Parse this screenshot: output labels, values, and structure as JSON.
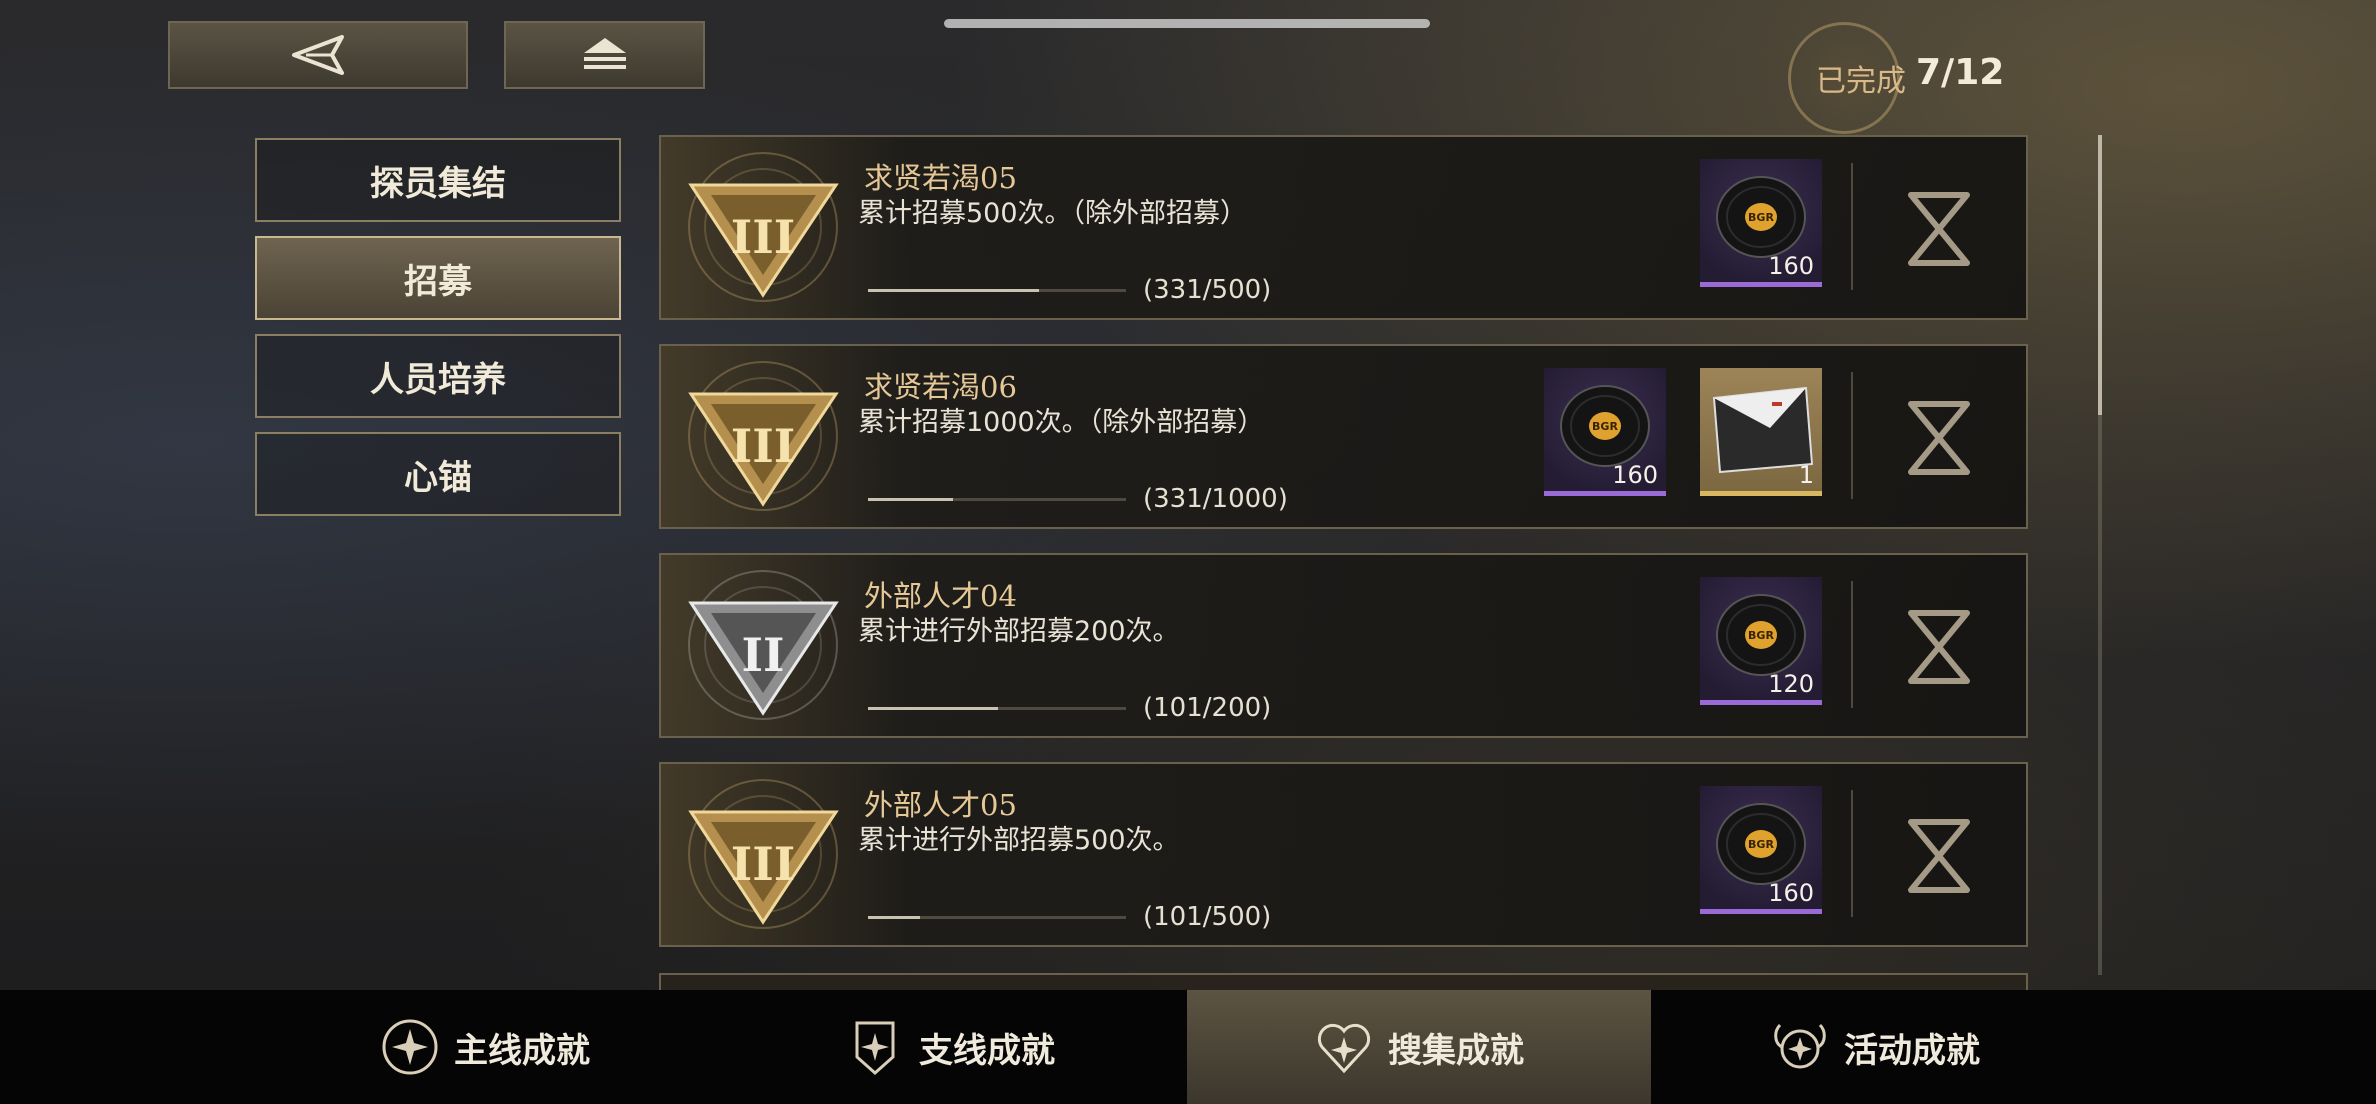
{
  "nav": {
    "back_label": "back",
    "home_label": "home"
  },
  "progress": {
    "label": "已完成",
    "value": "7/12"
  },
  "sidebar": {
    "items": [
      {
        "label": "探员集结",
        "active": false
      },
      {
        "label": "招募",
        "active": true
      },
      {
        "label": "人员培养",
        "active": false
      },
      {
        "label": "心锚",
        "active": false
      }
    ]
  },
  "achievements": [
    {
      "tier": "III",
      "tier_color": "gold",
      "title": "求贤若渴05",
      "description": "累计招募500次。（除外部招募）",
      "progress_text": "(331/500)",
      "progress": 0.662,
      "rewards": [
        {
          "icon": "vinyl-record-icon",
          "quantity": "160"
        }
      ],
      "status_icon": "hourglass-icon"
    },
    {
      "tier": "III",
      "tier_color": "gold",
      "title": "求贤若渴06",
      "description": "累计招募1000次。（除外部招募）",
      "progress_text": "(331/1000)",
      "progress": 0.331,
      "rewards": [
        {
          "icon": "vinyl-record-icon",
          "quantity": "160"
        },
        {
          "icon": "card-item-icon",
          "quantity": "1"
        }
      ],
      "status_icon": "hourglass-icon"
    },
    {
      "tier": "II",
      "tier_color": "silver",
      "title": "外部人才04",
      "description": "累计进行外部招募200次。",
      "progress_text": "(101/200)",
      "progress": 0.505,
      "rewards": [
        {
          "icon": "vinyl-record-icon",
          "quantity": "120"
        }
      ],
      "status_icon": "hourglass-icon"
    },
    {
      "tier": "III",
      "tier_color": "gold",
      "title": "外部人才05",
      "description": "累计进行外部招募500次。",
      "progress_text": "(101/500)",
      "progress": 0.202,
      "rewards": [
        {
          "icon": "vinyl-record-icon",
          "quantity": "160"
        }
      ],
      "status_icon": "hourglass-icon"
    }
  ],
  "bottom_tabs": [
    {
      "label": "主线成就",
      "icon": "compass-star-icon",
      "active": false
    },
    {
      "label": "支线成就",
      "icon": "shield-star-icon",
      "active": false
    },
    {
      "label": "搜集成就",
      "icon": "heart-star-icon",
      "active": true
    },
    {
      "label": "活动成就",
      "icon": "winged-star-icon",
      "active": false
    }
  ],
  "colors": {
    "accent_gold": "#e6c896",
    "reward_purple": "#9a6ad6",
    "panel_border": "#6a614d"
  }
}
